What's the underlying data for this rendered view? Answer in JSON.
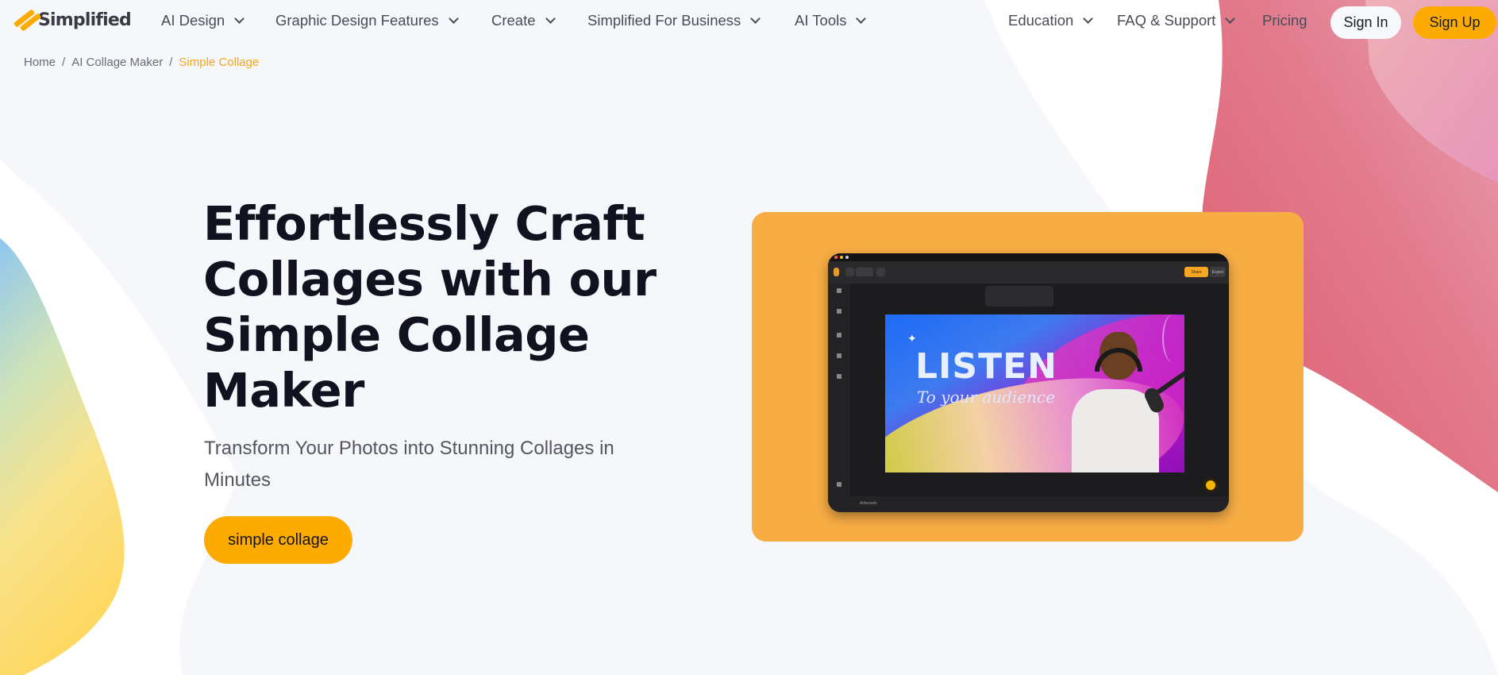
{
  "brand": {
    "name": "Simplified",
    "accent": "#FDAB00",
    "card_color": "#F7AC44"
  },
  "nav": {
    "items": [
      {
        "label": "AI Design",
        "dropdown": true
      },
      {
        "label": "Graphic Design Features",
        "dropdown": true
      },
      {
        "label": "Create",
        "dropdown": true
      },
      {
        "label": "Simplified For Business",
        "dropdown": true
      },
      {
        "label": "AI Tools",
        "dropdown": true
      },
      {
        "label": "Education",
        "dropdown": true
      },
      {
        "label": "FAQ & Support",
        "dropdown": true
      },
      {
        "label": "Pricing",
        "dropdown": false
      }
    ],
    "sign_in": "Sign In",
    "sign_up": "Sign Up"
  },
  "breadcrumb": [
    {
      "label": "Home"
    },
    {
      "label": "AI Collage Maker"
    },
    {
      "label": "Simple Collage",
      "active": true
    }
  ],
  "breadcrumb_separator": "/",
  "hero": {
    "title": "Effortlessly Craft Collages with our Simple Collage Maker",
    "subtitle": "Transform Your Photos into Stunning Collages in Minutes",
    "cta": "simple collage"
  },
  "preview": {
    "headline": "LISTEN",
    "script_text": "To your audience",
    "share_label": "Share",
    "export_label": "Export",
    "artboards_label": "Artboards"
  }
}
